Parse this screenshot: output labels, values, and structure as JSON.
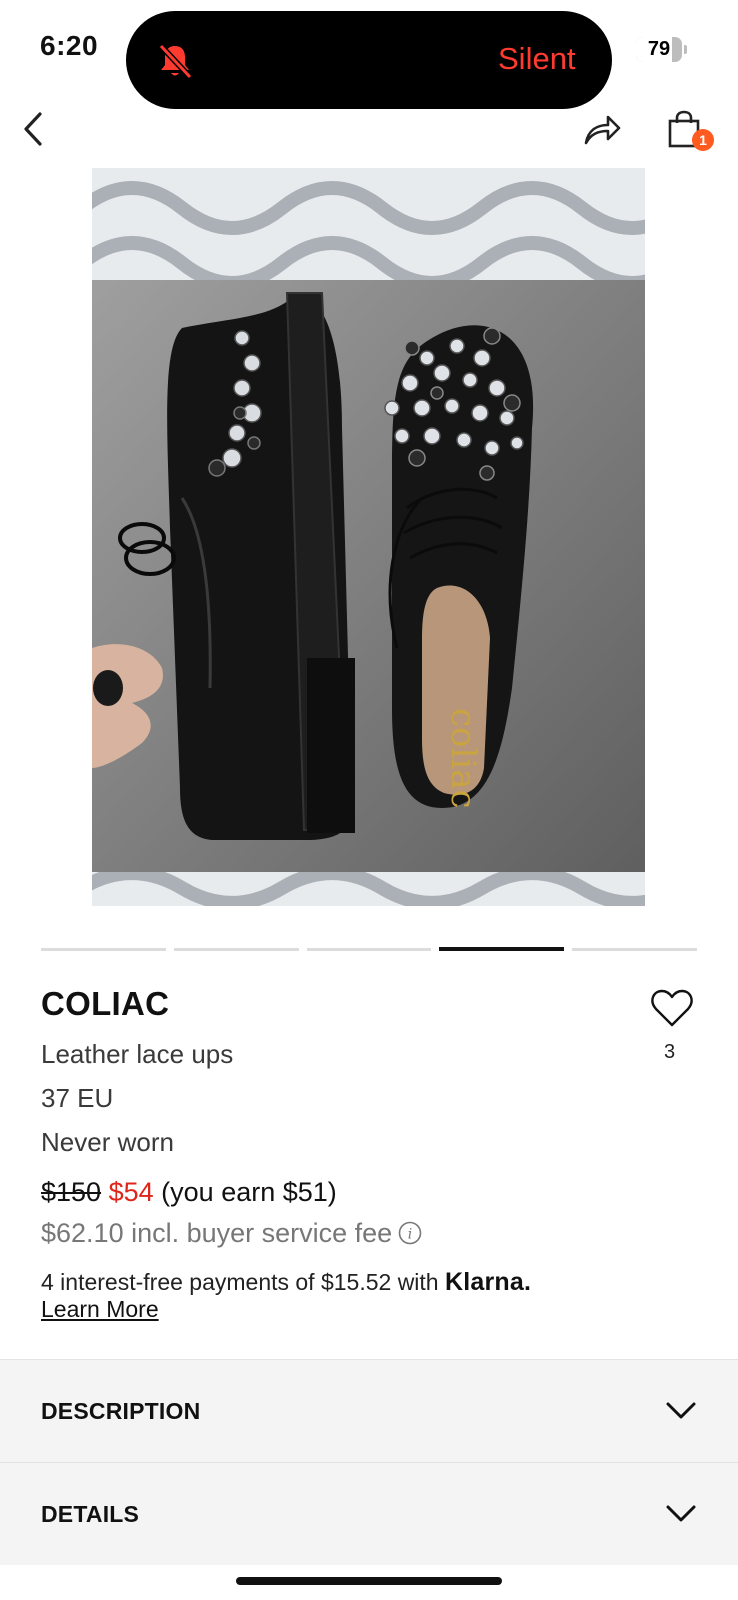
{
  "status_bar": {
    "time": "6:20",
    "silent_label": "Silent",
    "battery_percent": "79",
    "battery_level": 0.79,
    "accent_color": "#ff3b30"
  },
  "nav": {
    "back_icon": "chevron-left-icon",
    "share_icon": "share-icon",
    "cart_icon": "shopping-bag-icon",
    "cart_count": "1"
  },
  "gallery": {
    "image_description": "photo",
    "page_count": 5,
    "active_page": 4
  },
  "product": {
    "brand": "COLIAC",
    "title": "Leather lace ups",
    "size": "37 EU",
    "condition": "Never worn",
    "like_count": "3",
    "original_price": "$150",
    "price": "$54",
    "earn_text": "(you earn $51)",
    "fee_text": "$62.10 incl. buyer service fee",
    "price_color": "#e0251b"
  },
  "klarna": {
    "text": "4 interest-free payments of $15.52 with",
    "brand": "Klarna.",
    "learn_more": "Learn More"
  },
  "sections": {
    "description": "DESCRIPTION",
    "details": "DETAILS"
  }
}
